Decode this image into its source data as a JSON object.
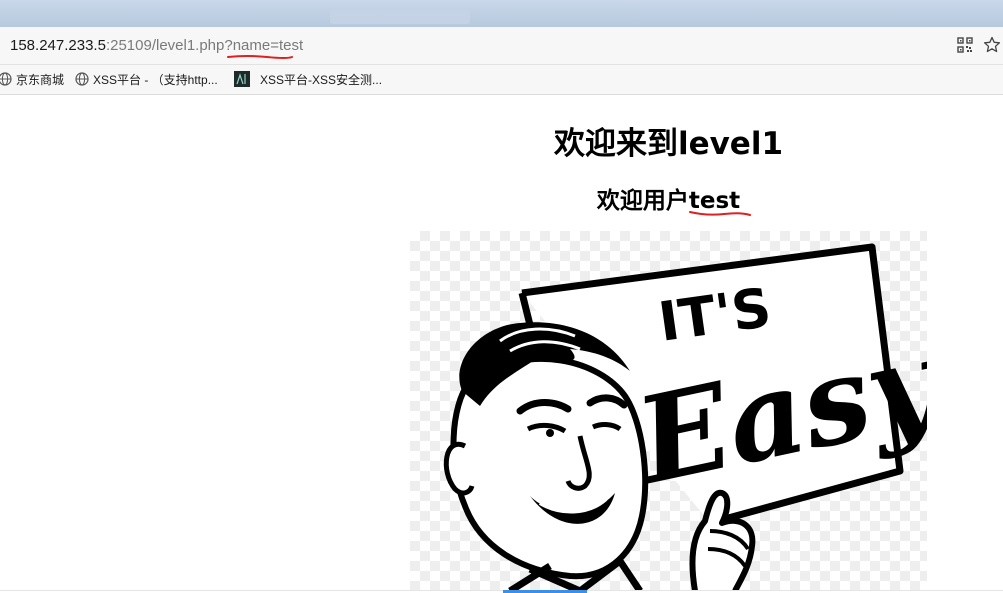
{
  "address_bar": {
    "host": "158.247.233.5",
    "path": ":25109/level1.php?",
    "query": "name=test"
  },
  "bookmarks": [
    {
      "label": "京东商城",
      "icon": "jd-icon"
    },
    {
      "label": "XSS平台 - （支持http...",
      "icon": "globe-icon"
    },
    {
      "label": "XSS平台-XSS安全测...",
      "icon": "site-icon"
    }
  ],
  "page": {
    "title": "欢迎来到level1",
    "welcome_prefix": "欢迎用户",
    "username": "test"
  },
  "image": {
    "sign_line1": "IT'S",
    "sign_line2": "Easy"
  },
  "colors": {
    "annotation_red": "#e02020",
    "progress_blue": "#3c8fe6"
  }
}
